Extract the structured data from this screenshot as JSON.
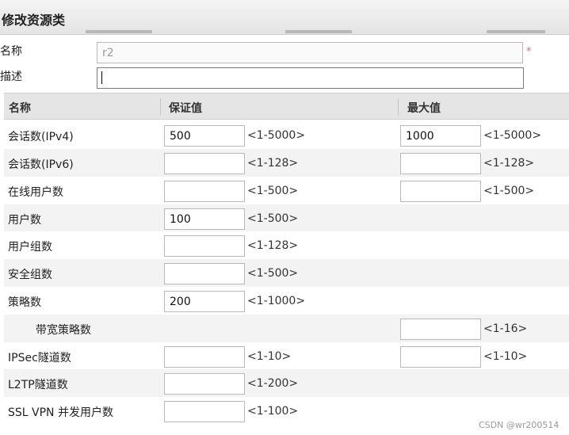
{
  "dialog": {
    "title": "修改资源类"
  },
  "form": {
    "name_label": "名称",
    "name_value": "r2",
    "required_mark": "*",
    "desc_label": "描述",
    "desc_value": ""
  },
  "table": {
    "headers": {
      "name": "名称",
      "guaranteed": "保证值",
      "max": "最大值"
    },
    "rows": [
      {
        "label": "会话数(IPv4)",
        "guaranteed": "500",
        "guaranteed_range": "<1-5000>",
        "max": "1000",
        "max_range": "<1-5000>"
      },
      {
        "label": "会话数(IPv6)",
        "guaranteed": "",
        "guaranteed_range": "<1-128>",
        "max": "",
        "max_range": "<1-128>"
      },
      {
        "label": "在线用户数",
        "guaranteed": "",
        "guaranteed_range": "<1-500>",
        "max": "",
        "max_range": "<1-500>"
      },
      {
        "label": "用户数",
        "guaranteed": "100",
        "guaranteed_range": "<1-500>"
      },
      {
        "label": "用户组数",
        "guaranteed": "",
        "guaranteed_range": "<1-128>"
      },
      {
        "label": "安全组数",
        "guaranteed": "",
        "guaranteed_range": "<1-500>"
      },
      {
        "label": "策略数",
        "guaranteed": "200",
        "guaranteed_range": "<1-1000>"
      },
      {
        "label": "带宽策略数",
        "max": "",
        "max_range": "<1-16>"
      },
      {
        "label": "IPSec隧道数",
        "guaranteed": "",
        "guaranteed_range": "<1-10>",
        "max": "",
        "max_range": "<1-10>"
      },
      {
        "label": "L2TP隧道数",
        "guaranteed": "",
        "guaranteed_range": "<1-200>"
      },
      {
        "label": "SSL VPN 并发用户数",
        "guaranteed": "",
        "guaranteed_range": "<1-100>"
      }
    ]
  },
  "watermark": "CSDN @wr200514"
}
